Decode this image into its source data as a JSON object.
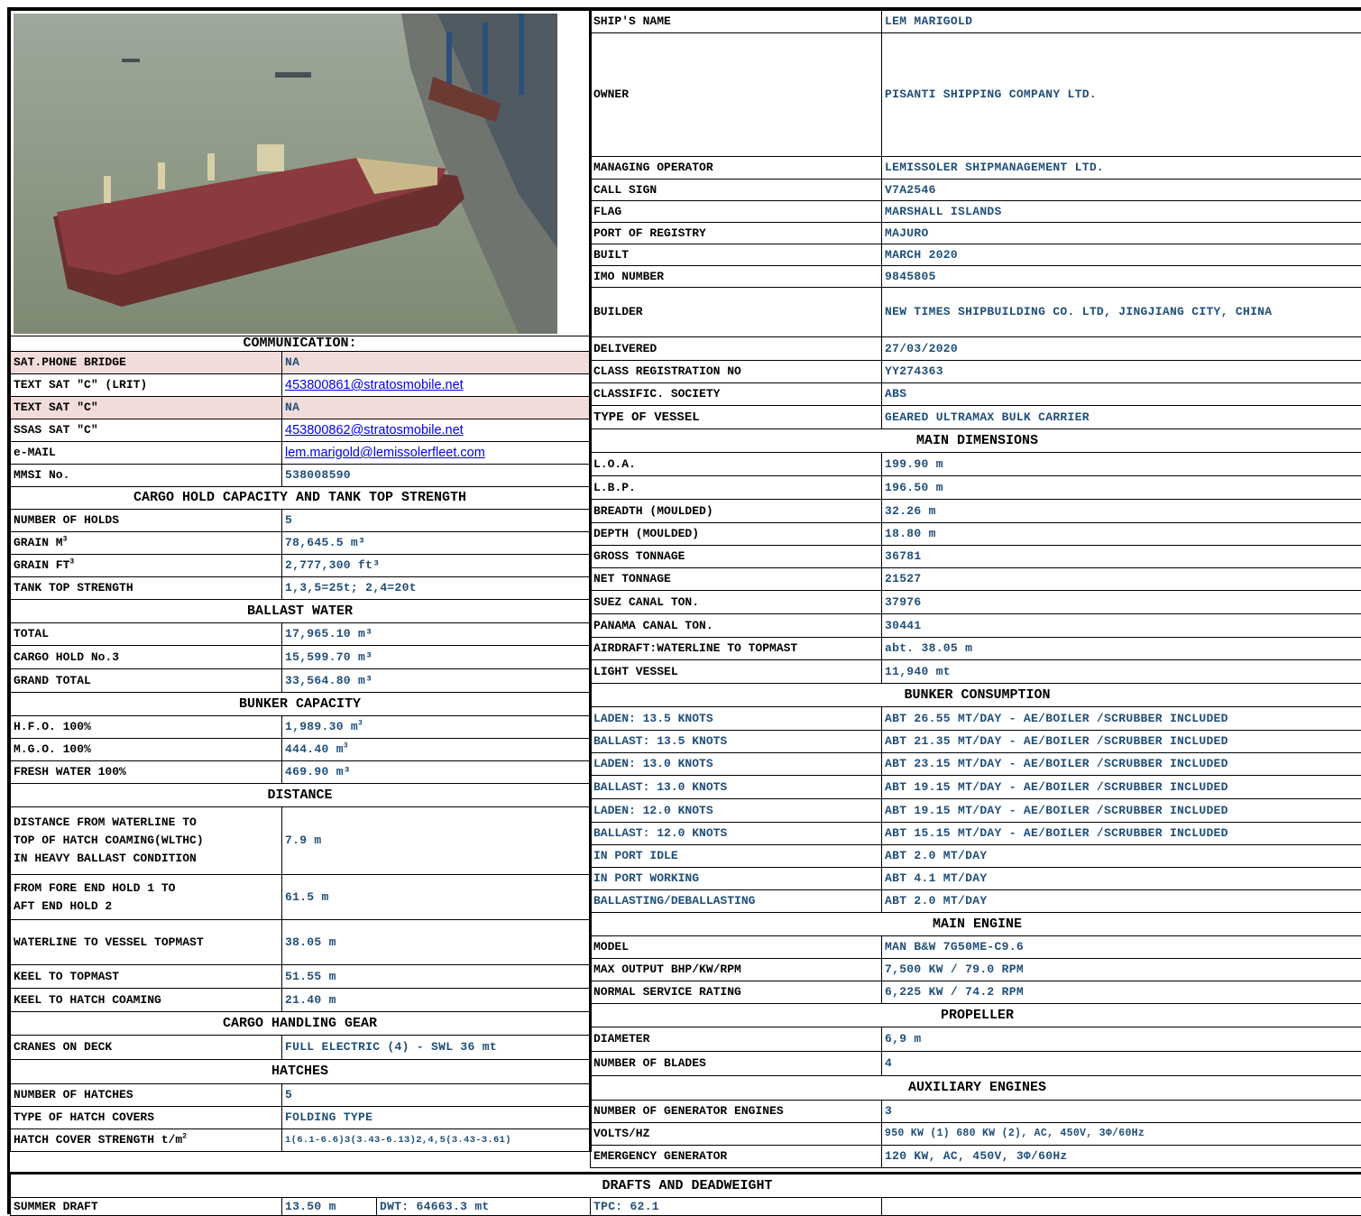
{
  "ship_info": [
    {
      "label": "SHIP'S NAME",
      "value": "LEM MARIGOLD"
    },
    {
      "label": "OWNER",
      "value": "PISANTI  SHIPPING COMPANY LTD."
    },
    {
      "label": "MANAGING OPERATOR",
      "value": "LEMISSOLER SHIPMANAGEMENT LTD."
    },
    {
      "label": "CALL SIGN",
      "value": "V7A2546"
    },
    {
      "label": "FLAG",
      "value": "MARSHALL ISLANDS"
    },
    {
      "label": "PORT OF REGISTRY",
      "value": "MAJURO"
    },
    {
      "label": "BUILT",
      "value": "MARCH 2020"
    },
    {
      "label": "IMO NUMBER",
      "value": "9845805"
    },
    {
      "label": "BUILDER",
      "value": "NEW TIMES SHIPBUILDING CO. LTD, JINGJIANG CITY, CHINA"
    },
    {
      "label": "DELIVERED",
      "value": "27/03/2020"
    },
    {
      "label": "CLASS REGISTRATION NO",
      "value": "YY274363"
    },
    {
      "label": "CLASSIFIC. SOCIETY",
      "value": "ABS"
    },
    {
      "label": "TYPE OF VESSEL",
      "value": "GEARED ULTRAMAX BULK CARRIER"
    }
  ],
  "main_dimensions": {
    "title": "MAIN DIMENSIONS",
    "rows": [
      {
        "label": "L.O.A.",
        "value": "199.90 m"
      },
      {
        "label": "L.B.P.",
        "value": "196.50 m"
      },
      {
        "label": "BREADTH (MOULDED)",
        "value": "32.26  m"
      },
      {
        "label": "DEPTH (MOULDED)",
        "value": "18.80  m"
      },
      {
        "label": "GROSS TONNAGE",
        "value": "36781"
      },
      {
        "label": "NET TONNAGE",
        "value": "21527"
      },
      {
        "label": "SUEZ CANAL TON.",
        "value": "37976"
      },
      {
        "label": "PANAMA CANAL TON.",
        "value": "30441"
      },
      {
        "label": "AIRDRAFT:WATERLINE TO TOPMAST",
        "value": "abt. 38.05 m"
      },
      {
        "label": "LIGHT VESSEL",
        "value": "11,940 mt"
      }
    ]
  },
  "bunker_consumption": {
    "title": "BUNKER CONSUMPTION",
    "rows": [
      {
        "label": "LADEN: 13.5 KNOTS",
        "value": "ABT 26.55 MT/DAY - AE/BOILER /SCRUBBER INCLUDED"
      },
      {
        "label": "BALLAST: 13.5 KNOTS",
        "value": "ABT 21.35 MT/DAY - AE/BOILER /SCRUBBER INCLUDED"
      },
      {
        "label": "LADEN: 13.0 KNOTS",
        "value": "ABT 23.15 MT/DAY - AE/BOILER /SCRUBBER INCLUDED"
      },
      {
        "label": "BALLAST: 13.0 KNOTS",
        "value": "ABT 19.15 MT/DAY - AE/BOILER /SCRUBBER INCLUDED"
      },
      {
        "label": "LADEN: 12.0 KNOTS",
        "value": "ABT 19.15 MT/DAY - AE/BOILER /SCRUBBER INCLUDED"
      },
      {
        "label": "BALLAST: 12.0 KNOTS",
        "value": "ABT 15.15 MT/DAY - AE/BOILER /SCRUBBER INCLUDED"
      },
      {
        "label": "IN PORT IDLE",
        "value": "ABT  2.0 MT/DAY"
      },
      {
        "label": "IN PORT WORKING",
        "value": "ABT  4.1 MT/DAY"
      },
      {
        "label": "BALLASTING/DEBALLASTING",
        "value": "ABT  2.0 MT/DAY"
      }
    ]
  },
  "main_engine": {
    "title": "MAIN ENGINE",
    "rows": [
      {
        "label": "MODEL",
        "value": "MAN B&W 7G50ME-C9.6"
      },
      {
        "label": "MAX OUTPUT BHP/KW/RPM",
        "value": "7,500 KW / 79.0 RPM"
      },
      {
        "label": "NORMAL SERVICE RATING",
        "value": "6,225 KW / 74.2 RPM"
      }
    ]
  },
  "propeller": {
    "title": "PROPELLER",
    "rows": [
      {
        "label": "DIAMETER",
        "value": "6,9 m"
      },
      {
        "label": "NUMBER OF BLADES",
        "value": "4"
      }
    ]
  },
  "auxiliary_engines": {
    "title": "AUXILIARY ENGINES",
    "rows": [
      {
        "label": "NUMBER OF GENERATOR ENGINES",
        "value": "3"
      },
      {
        "label": "VOLTS/HZ",
        "value": "950 KW (1) 680 KW (2), AC, 450V, 3Φ/60Hz"
      },
      {
        "label": "EMERGENCY GENERATOR",
        "value": "120 KW, AC, 450V, 3Φ/60Hz"
      }
    ]
  },
  "communication": {
    "title": "COMMUNICATION:",
    "rows": [
      {
        "label": "SAT.PHONE BRIDGE",
        "value": "NA"
      },
      {
        "label": "TEXT SAT \"C\" (LRIT)",
        "value": "453800861@stratosmobile.net"
      },
      {
        "label": "TEXT SAT \"C\"",
        "value": "NA"
      },
      {
        "label": "SSAS SAT \"C\"",
        "value": "453800862@stratosmobile.net"
      },
      {
        "label": "e-MAIL",
        "value": "lem.marigold@lemissolerfleet.com"
      },
      {
        "label": "MMSI No.",
        "value": "538008590"
      }
    ]
  },
  "cargo_hold": {
    "title": "CARGO HOLD CAPACITY AND TANK TOP STRENGTH",
    "rows": [
      {
        "label": "NUMBER OF HOLDS",
        "value": "5"
      },
      {
        "label": "GRAIN M",
        "value": "78,645.5 m³"
      },
      {
        "label": "GRAIN FT",
        "value": "2,777,300 ft³"
      },
      {
        "label": "TANK TOP STRENGTH",
        "value": "1,3,5=25t; 2,4=20t"
      }
    ]
  },
  "ballast_water": {
    "title": "BALLAST WATER",
    "rows": [
      {
        "label": "TOTAL",
        "value": "17,965.10 m³"
      },
      {
        "label": "CARGO HOLD No.3",
        "value": "15,599.70 m³"
      },
      {
        "label": "GRAND TOTAL",
        "value": "33,564.80 m³"
      }
    ]
  },
  "bunker_capacity": {
    "title": "BUNKER CAPACITY",
    "rows": [
      {
        "label": "H.F.O. 100%",
        "value": "1,989.30 m"
      },
      {
        "label": "M.G.O. 100%",
        "value": "444.40 m"
      },
      {
        "label": "FRESH WATER 100%",
        "value": "469.90 m³"
      }
    ]
  },
  "distance": {
    "title": "DISTANCE",
    "rows": [
      {
        "label_lines": [
          "DISTANCE FROM WATERLINE TO",
          "TOP OF HATCH COAMING(WLTHC)",
          "IN HEAVY BALLAST CONDITION"
        ],
        "value": "7.9 m"
      },
      {
        "label_lines": [
          "FROM FORE END HOLD 1 TO",
          "AFT END HOLD 2"
        ],
        "value": "61.5 m"
      },
      {
        "label": "WATERLINE TO VESSEL TOPMAST",
        "value": "38.05 m"
      },
      {
        "label": "KEEL TO TOPMAST",
        "value": "51.55 m"
      },
      {
        "label": "KEEL TO HATCH COAMING",
        "value": "21.40 m"
      }
    ]
  },
  "cargo_handling_gear": {
    "title": "CARGO HANDLING GEAR",
    "rows": [
      {
        "label": "CRANES ON DECK",
        "value": "FULL ELECTRIC (4) - SWL 36 mt"
      }
    ]
  },
  "hatches": {
    "title": "HATCHES",
    "rows": [
      {
        "label": "NUMBER OF HATCHES",
        "value": "5"
      },
      {
        "label": "TYPE OF HATCH COVERS",
        "value": "FOLDING TYPE"
      },
      {
        "label": "HATCH COVER STRENGTH t/m",
        "value": "1(6.1-6.6)3(3.43-6.13)2,4,5(3.43-3.61)"
      }
    ]
  },
  "drafts": {
    "title": "DRAFTS AND DEADWEIGHT",
    "summer_label": "SUMMER DRAFT",
    "summer_draft": "13.50 m",
    "dwt": "DWT: 64663.3 mt",
    "tpc": "TPC: 62.1"
  },
  "colors": {
    "value_blue": "#1f4e79",
    "link_blue": "#0000ee",
    "pink_row": "#f2dcdb"
  },
  "photo_icon": "ship-photo"
}
